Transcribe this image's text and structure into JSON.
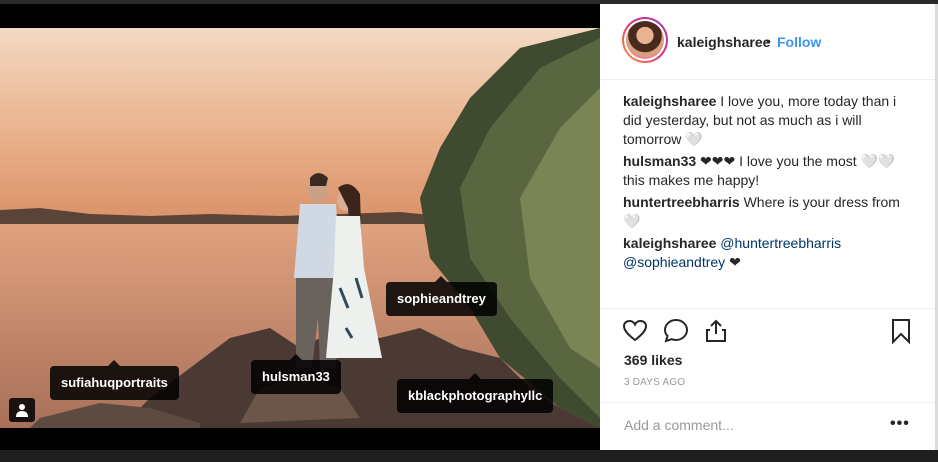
{
  "post": {
    "username": "kaleighsharee",
    "separator": "•",
    "follow_label": "Follow"
  },
  "photo": {
    "tags": [
      {
        "label": "sophieandtrey"
      },
      {
        "label": "sufiahuqportraits"
      },
      {
        "label": "hulsman33"
      },
      {
        "label": "kblackphotographyllc"
      }
    ]
  },
  "comments": [
    {
      "user": "kaleighsharee",
      "text": "I love you, more today than i did yesterday, but not as much as i will tomorrow 🤍"
    },
    {
      "user": "hulsman33",
      "text": "❤❤❤ I love you the most 🤍🤍 this makes me happy!"
    },
    {
      "user": "huntertreebharris",
      "text": "Where is your dress from 🤍"
    },
    {
      "user": "kaleighsharee",
      "mention1": "@huntertreebharris",
      "mention2": "@sophieandtrey",
      "text": "❤"
    }
  ],
  "actions": {
    "like_icon": "heart-outline",
    "comment_icon": "speech-bubble",
    "share_icon": "share-arrow",
    "save_icon": "bookmark"
  },
  "likes_label": "369 likes",
  "timestamp": "3 DAYS AGO",
  "comment_placeholder": "Add a comment...",
  "more_label": "•••"
}
